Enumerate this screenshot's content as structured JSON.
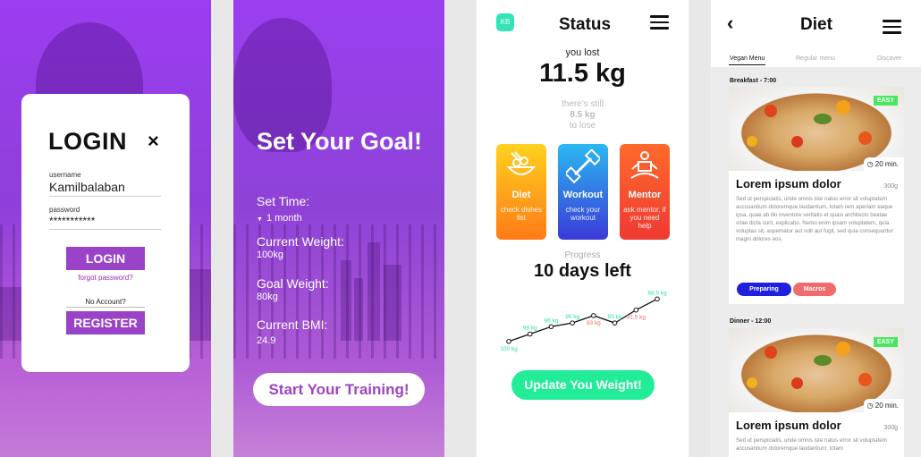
{
  "login": {
    "title": "LOGIN",
    "close_icon": "×",
    "username_label": "username",
    "username_value": "Kamilbalaban",
    "password_label": "password",
    "password_value": "***********",
    "login_button": "LOGIN",
    "forgot": "forgot password?",
    "no_account": "No Account?",
    "register_button": "REGISTER"
  },
  "goal": {
    "title": "Set Your Goal!",
    "set_time_label": "Set Time:",
    "set_time_value": "1 month",
    "current_weight_label": "Current Weight:",
    "current_weight_value": "100kg",
    "goal_weight_label": "Goal Weight:",
    "goal_weight_value": "80kg",
    "bmi_label": "Current BMI:",
    "bmi_value": "24.9",
    "start_button": "Start Your Training!"
  },
  "status": {
    "badge": "KB",
    "title": "Status",
    "you_lost": "you lost",
    "lost_value": "11.5 kg",
    "still_text": "there's still",
    "still_value": "8.5 kg",
    "to_lose": "to lose",
    "tiles": [
      {
        "name": "Diet",
        "sub": "check dishes list",
        "icon": "food-bowl-icon",
        "colors": [
          "#ffd21e",
          "#ff7a18"
        ]
      },
      {
        "name": "Workout",
        "sub": "check your workout",
        "icon": "dumbbell-icon",
        "colors": [
          "#2bb8f2",
          "#3b3ad8"
        ]
      },
      {
        "name": "Mentor",
        "sub": "ask mentor, if you need help",
        "icon": "meditation-icon",
        "colors": [
          "#ff6a2b",
          "#ee3a33"
        ]
      }
    ],
    "progress_label": "Progress",
    "days_left": "10 days left",
    "update_button": "Update You Weight!"
  },
  "chart_data": {
    "type": "line",
    "title": "",
    "xlabel": "",
    "ylabel": "",
    "labels": [
      "100 kg",
      "98 kg",
      "96 kg",
      "95 kg",
      "93 kg",
      "95 kg",
      "91,5 kg",
      "88,5 kg"
    ],
    "values": [
      100,
      98,
      96,
      95,
      93,
      95,
      91.5,
      88.5
    ],
    "label_colors": [
      "#2fe29a",
      "#2fe29a",
      "#2fe29a",
      "#2fe29a",
      "#f06a6a",
      "#2fe29a",
      "#f06a6a",
      "#2fe29a"
    ],
    "label_side": [
      "below",
      "above",
      "above",
      "above",
      "below",
      "above",
      "below",
      "above"
    ],
    "ylim": [
      86,
      102
    ],
    "grid": false
  },
  "diet": {
    "title": "Diet",
    "tabs": [
      "Vegan Menu",
      "Regular menu",
      "Discover"
    ],
    "meals": [
      {
        "label": "Breakfast - 7:00",
        "badge": "EASY",
        "time": "20 min.",
        "title": "Lorem ipsum dolor",
        "weight": "300g",
        "desc": "Sed ut perspiciatis, unde omnis iste natus error sit voluptatem accusantium doloremque laudantium, totam rem aperiam eaque ipsa, quae ab illo inventore veritatis et quasi architecto beatae vitae dicta sunt, explicabo. Nemo enim ipsam voluptatem, quia voluptas sit, aspernatur aut odit aut fugit, sed quia consequuntur magni dolores eos.",
        "tags": [
          "Preparing",
          "Macros"
        ]
      },
      {
        "label": "Dinner - 12:00",
        "badge": "EASY",
        "time": "20 min.",
        "title": "Lorem ipsum dolor",
        "weight": "300g",
        "desc": "Sed ut perspiciatis, unde omnis iste natus error sit voluptatem accusantium doloremque laudantium, totam",
        "tags": []
      }
    ],
    "tag_colors": [
      "#1f1fe0",
      "#f06b6b"
    ]
  }
}
